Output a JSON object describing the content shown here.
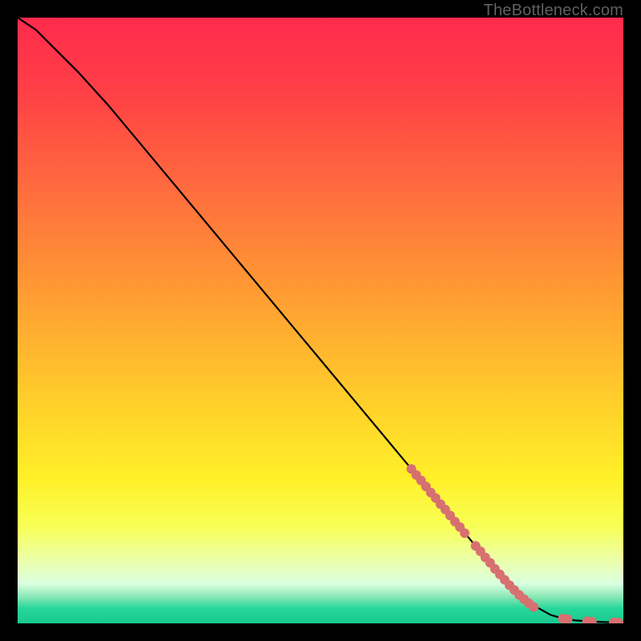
{
  "watermark": "TheBottleneck.com",
  "colors": {
    "curve": "#000000",
    "marker": "#d77070",
    "background_black": "#000000"
  },
  "gradient_stops": [
    {
      "offset": 0.0,
      "color": "#ff2a4d"
    },
    {
      "offset": 0.12,
      "color": "#ff3f46"
    },
    {
      "offset": 0.28,
      "color": "#ff6b3e"
    },
    {
      "offset": 0.45,
      "color": "#ff9a33"
    },
    {
      "offset": 0.62,
      "color": "#ffcb2b"
    },
    {
      "offset": 0.76,
      "color": "#fff028"
    },
    {
      "offset": 0.84,
      "color": "#f8ff55"
    },
    {
      "offset": 0.9,
      "color": "#eaffb0"
    },
    {
      "offset": 0.935,
      "color": "#d8ffe0"
    },
    {
      "offset": 0.955,
      "color": "#8fe8b8"
    },
    {
      "offset": 0.975,
      "color": "#28d79a"
    },
    {
      "offset": 1.0,
      "color": "#17c98f"
    }
  ],
  "chart_data": {
    "type": "line",
    "title": "",
    "xlabel": "",
    "ylabel": "",
    "xlim": [
      0,
      100
    ],
    "ylim": [
      0,
      100
    ],
    "series": [
      {
        "name": "curve",
        "x": [
          0,
          3,
          6,
          10,
          15,
          20,
          25,
          30,
          35,
          40,
          45,
          50,
          55,
          60,
          65,
          70,
          75,
          80,
          84,
          88,
          90,
          92,
          94,
          96,
          98,
          100
        ],
        "y": [
          100,
          98,
          95,
          91,
          85.5,
          79.5,
          73.5,
          67.5,
          61.5,
          55.5,
          49.5,
          43.5,
          37.5,
          31.5,
          25.5,
          19.5,
          13.5,
          7.8,
          3.6,
          1.4,
          0.8,
          0.5,
          0.35,
          0.25,
          0.18,
          0.14
        ]
      }
    ],
    "markers": [
      {
        "x": 65.0,
        "y": 25.5,
        "r": 6
      },
      {
        "x": 65.8,
        "y": 24.5,
        "r": 6
      },
      {
        "x": 66.6,
        "y": 23.6,
        "r": 6
      },
      {
        "x": 67.4,
        "y": 22.6,
        "r": 6
      },
      {
        "x": 68.2,
        "y": 21.6,
        "r": 6
      },
      {
        "x": 69.0,
        "y": 20.7,
        "r": 6
      },
      {
        "x": 69.8,
        "y": 19.7,
        "r": 6
      },
      {
        "x": 70.6,
        "y": 18.8,
        "r": 6
      },
      {
        "x": 71.4,
        "y": 17.8,
        "r": 6
      },
      {
        "x": 72.2,
        "y": 16.8,
        "r": 6
      },
      {
        "x": 73.0,
        "y": 15.9,
        "r": 6
      },
      {
        "x": 73.8,
        "y": 14.9,
        "r": 6
      },
      {
        "x": 75.6,
        "y": 12.8,
        "r": 6
      },
      {
        "x": 76.4,
        "y": 11.9,
        "r": 6
      },
      {
        "x": 77.2,
        "y": 10.9,
        "r": 6
      },
      {
        "x": 78.0,
        "y": 10.0,
        "r": 6
      },
      {
        "x": 78.8,
        "y": 9.0,
        "r": 6
      },
      {
        "x": 79.6,
        "y": 8.1,
        "r": 6
      },
      {
        "x": 80.4,
        "y": 7.2,
        "r": 6
      },
      {
        "x": 81.2,
        "y": 6.3,
        "r": 6
      },
      {
        "x": 82.0,
        "y": 5.5,
        "r": 6
      },
      {
        "x": 82.8,
        "y": 4.7,
        "r": 6
      },
      {
        "x": 83.6,
        "y": 4.0,
        "r": 6
      },
      {
        "x": 84.4,
        "y": 3.3,
        "r": 6
      },
      {
        "x": 85.2,
        "y": 2.7,
        "r": 6
      },
      {
        "x": 90.0,
        "y": 0.8,
        "r": 6
      },
      {
        "x": 90.8,
        "y": 0.7,
        "r": 6
      },
      {
        "x": 94.0,
        "y": 0.35,
        "r": 6
      },
      {
        "x": 94.8,
        "y": 0.3,
        "r": 6
      },
      {
        "x": 98.4,
        "y": 0.17,
        "r": 6
      },
      {
        "x": 99.2,
        "y": 0.15,
        "r": 6
      }
    ]
  }
}
